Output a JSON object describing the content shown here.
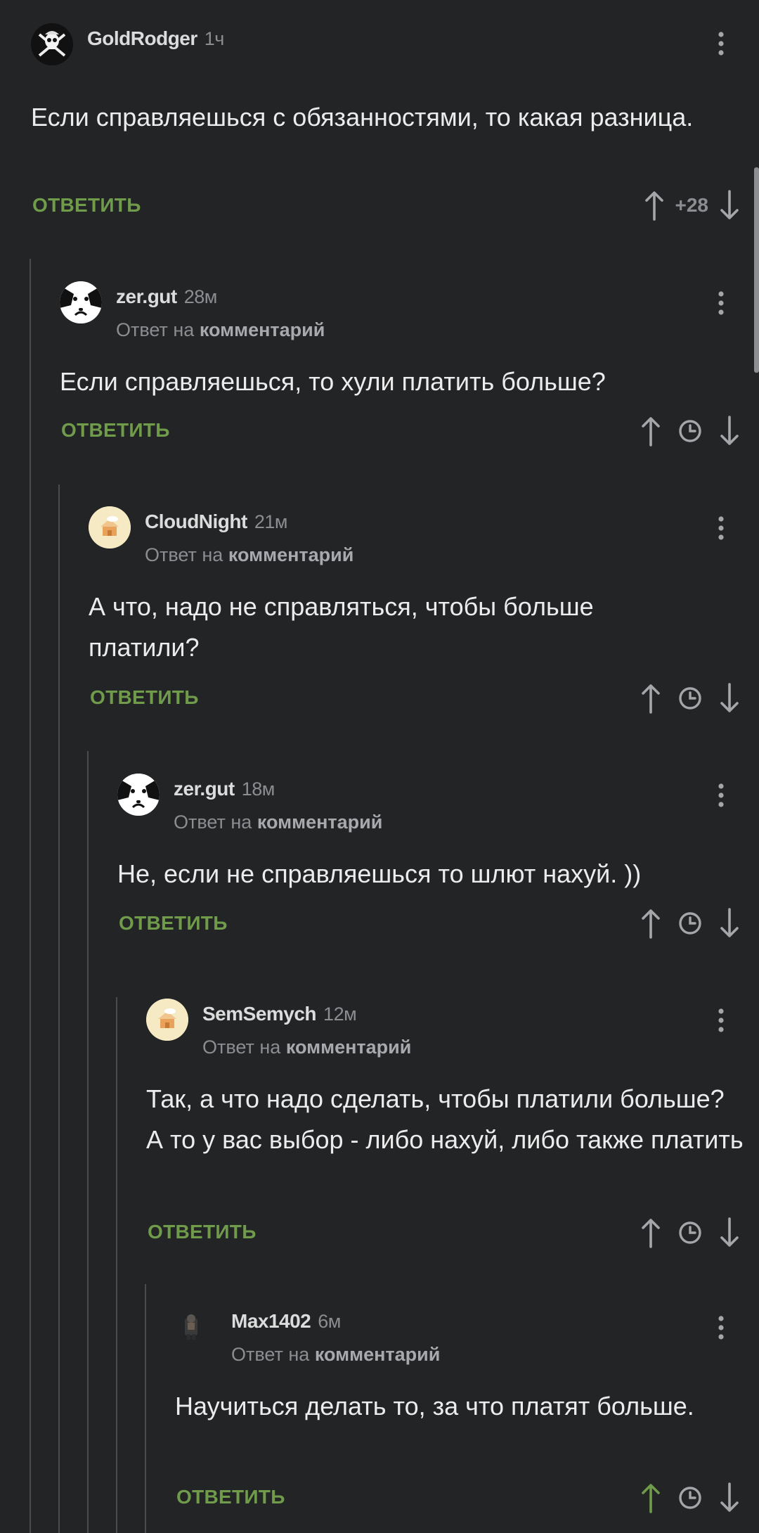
{
  "comments": [
    {
      "author": "GoldRodger",
      "time": "1ч",
      "reply_prefix": "",
      "reply_target": "",
      "text": "Если справляешься с обязанностями, то какая разница.",
      "reply_label": "ОТВЕТИТЬ",
      "rating": "+28",
      "avatar": "pirate-flag-avatar"
    },
    {
      "author": "zer.gut",
      "time": "28м",
      "reply_prefix": "Ответ на ",
      "reply_target": "комментарий",
      "text": "Если справляешься, то хули платить больше?",
      "reply_label": "ОТВЕТИТЬ",
      "avatar": "cow-avatar"
    },
    {
      "author": "CloudNight",
      "time": "21м",
      "reply_prefix": "Ответ на ",
      "reply_target": "комментарий",
      "text": "А что, надо не справляться, чтобы больше платили?",
      "reply_label": "ОТВЕТИТЬ",
      "avatar": "default-house-avatar"
    },
    {
      "author": "zer.gut",
      "time": "18м",
      "reply_prefix": "Ответ на ",
      "reply_target": "комментарий",
      "text": "Не, если не справляешься то шлют нахуй. ))",
      "reply_label": "ОТВЕТИТЬ",
      "avatar": "cow-avatar"
    },
    {
      "author": "SemSemych",
      "time": "12м",
      "reply_prefix": "Ответ на ",
      "reply_target": "комментарий",
      "text": "Так, а что надо сделать, чтобы платили больше? А то у вас выбор - либо нахуй, либо также платить",
      "reply_label": "ОТВЕТИТЬ",
      "avatar": "default-house-avatar"
    },
    {
      "author": "Max1402",
      "time": "6м",
      "reply_prefix": "Ответ на ",
      "reply_target": "комментарий",
      "text": "Научиться делать то, за что платят больше.",
      "reply_label": "ОТВЕТИТЬ",
      "avatar": "small-figure-avatar",
      "upvoted": true
    }
  ],
  "colors": {
    "background": "#222426",
    "accent_green": "#6f9b4a",
    "muted_text": "#8b8d90",
    "thread_line": "#4a4c4f"
  }
}
